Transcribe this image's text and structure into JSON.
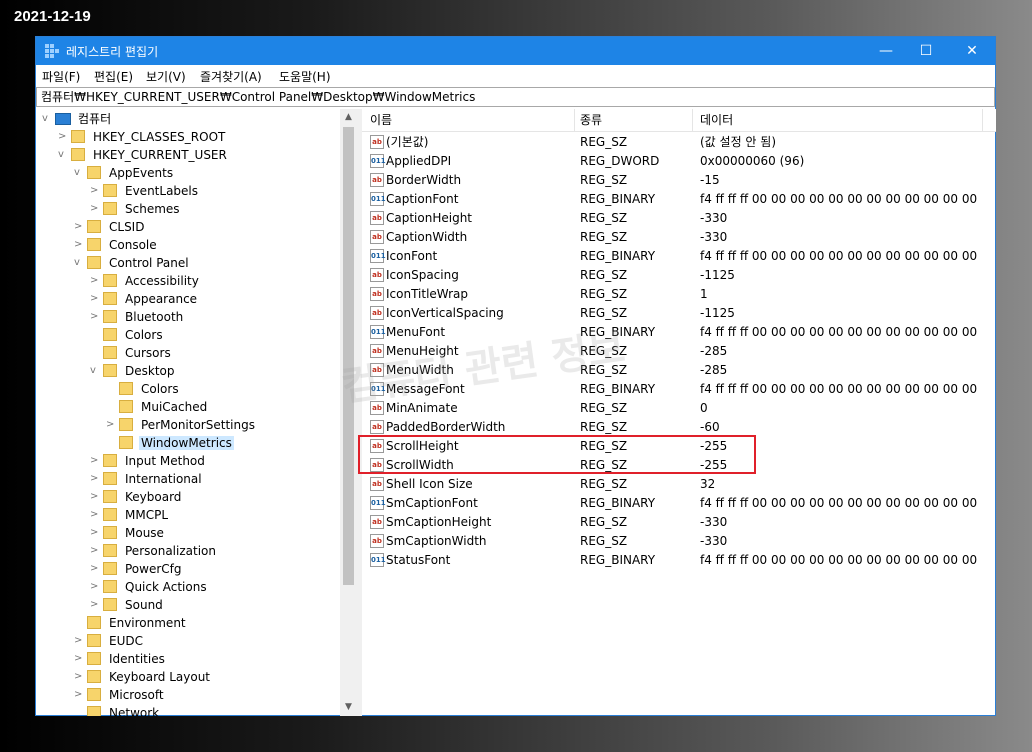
{
  "date_label": "2021-12-19",
  "window": {
    "title": "레지스트리 편집기",
    "minimize_glyph": "—",
    "maximize_glyph": "☐",
    "close_glyph": "✕",
    "title_icon": "registry-editor-icon"
  },
  "menubar": [
    "파일(F)",
    "편집(E)",
    "보기(V)",
    "즐겨찾기(A)",
    "도움말(H)"
  ],
  "address": "컴퓨터₩HKEY_CURRENT_USER₩Control Panel₩Desktop₩WindowMetrics",
  "tree": {
    "root": "컴퓨터",
    "nodes": [
      {
        "label": "HKEY_CLASSES_ROOT",
        "level": 1,
        "expander": ">"
      },
      {
        "label": "HKEY_CURRENT_USER",
        "level": 1,
        "expander": "v"
      },
      {
        "label": "AppEvents",
        "level": 2,
        "expander": "v"
      },
      {
        "label": "EventLabels",
        "level": 3,
        "expander": ">"
      },
      {
        "label": "Schemes",
        "level": 3,
        "expander": ">"
      },
      {
        "label": "CLSID",
        "level": 2,
        "expander": ">"
      },
      {
        "label": "Console",
        "level": 2,
        "expander": ">"
      },
      {
        "label": "Control Panel",
        "level": 2,
        "expander": "v"
      },
      {
        "label": "Accessibility",
        "level": 3,
        "expander": ">"
      },
      {
        "label": "Appearance",
        "level": 3,
        "expander": ">"
      },
      {
        "label": "Bluetooth",
        "level": 3,
        "expander": ">"
      },
      {
        "label": "Colors",
        "level": 3,
        "expander": ""
      },
      {
        "label": "Cursors",
        "level": 3,
        "expander": ""
      },
      {
        "label": "Desktop",
        "level": 3,
        "expander": "v"
      },
      {
        "label": "Colors",
        "level": 4,
        "expander": ""
      },
      {
        "label": "MuiCached",
        "level": 4,
        "expander": ""
      },
      {
        "label": "PerMonitorSettings",
        "level": 4,
        "expander": ">"
      },
      {
        "label": "WindowMetrics",
        "level": 4,
        "expander": "",
        "selected": true
      },
      {
        "label": "Input Method",
        "level": 3,
        "expander": ">"
      },
      {
        "label": "International",
        "level": 3,
        "expander": ">"
      },
      {
        "label": "Keyboard",
        "level": 3,
        "expander": ">"
      },
      {
        "label": "MMCPL",
        "level": 3,
        "expander": ">"
      },
      {
        "label": "Mouse",
        "level": 3,
        "expander": ">"
      },
      {
        "label": "Personalization",
        "level": 3,
        "expander": ">"
      },
      {
        "label": "PowerCfg",
        "level": 3,
        "expander": ">"
      },
      {
        "label": "Quick Actions",
        "level": 3,
        "expander": ">"
      },
      {
        "label": "Sound",
        "level": 3,
        "expander": ">"
      },
      {
        "label": "Environment",
        "level": 2,
        "expander": ""
      },
      {
        "label": "EUDC",
        "level": 2,
        "expander": ">"
      },
      {
        "label": "Identities",
        "level": 2,
        "expander": ">"
      },
      {
        "label": "Keyboard Layout",
        "level": 2,
        "expander": ">"
      },
      {
        "label": "Microsoft",
        "level": 2,
        "expander": ">"
      },
      {
        "label": "Network",
        "level": 2,
        "expander": ""
      }
    ]
  },
  "list": {
    "headers": [
      "이름",
      "종류",
      "데이터"
    ],
    "rows": [
      {
        "name": "(기본값)",
        "type": "REG_SZ",
        "data": "(값 설정 안 됨)",
        "icon": "ab"
      },
      {
        "name": "AppliedDPI",
        "type": "REG_DWORD",
        "data": "0x00000060 (96)",
        "icon": "bin"
      },
      {
        "name": "BorderWidth",
        "type": "REG_SZ",
        "data": "-15",
        "icon": "ab"
      },
      {
        "name": "CaptionFont",
        "type": "REG_BINARY",
        "data": "f4 ff ff ff 00 00 00 00 00 00 00 00 00 00 00 00 ...",
        "icon": "bin"
      },
      {
        "name": "CaptionHeight",
        "type": "REG_SZ",
        "data": "-330",
        "icon": "ab"
      },
      {
        "name": "CaptionWidth",
        "type": "REG_SZ",
        "data": "-330",
        "icon": "ab"
      },
      {
        "name": "IconFont",
        "type": "REG_BINARY",
        "data": "f4 ff ff ff 00 00 00 00 00 00 00 00 00 00 00 00 ...",
        "icon": "bin"
      },
      {
        "name": "IconSpacing",
        "type": "REG_SZ",
        "data": "-1125",
        "icon": "ab"
      },
      {
        "name": "IconTitleWrap",
        "type": "REG_SZ",
        "data": "1",
        "icon": "ab"
      },
      {
        "name": "IconVerticalSpacing",
        "type": "REG_SZ",
        "data": "-1125",
        "icon": "ab"
      },
      {
        "name": "MenuFont",
        "type": "REG_BINARY",
        "data": "f4 ff ff ff 00 00 00 00 00 00 00 00 00 00 00 00 ...",
        "icon": "bin"
      },
      {
        "name": "MenuHeight",
        "type": "REG_SZ",
        "data": "-285",
        "icon": "ab"
      },
      {
        "name": "MenuWidth",
        "type": "REG_SZ",
        "data": "-285",
        "icon": "ab"
      },
      {
        "name": "MessageFont",
        "type": "REG_BINARY",
        "data": "f4 ff ff ff 00 00 00 00 00 00 00 00 00 00 00 00 ...",
        "icon": "bin"
      },
      {
        "name": "MinAnimate",
        "type": "REG_SZ",
        "data": "0",
        "icon": "ab"
      },
      {
        "name": "PaddedBorderWidth",
        "type": "REG_SZ",
        "data": "-60",
        "icon": "ab"
      },
      {
        "name": "ScrollHeight",
        "type": "REG_SZ",
        "data": "-255",
        "icon": "ab"
      },
      {
        "name": "ScrollWidth",
        "type": "REG_SZ",
        "data": "-255",
        "icon": "ab"
      },
      {
        "name": "Shell Icon Size",
        "type": "REG_SZ",
        "data": "32",
        "icon": "ab"
      },
      {
        "name": "SmCaptionFont",
        "type": "REG_BINARY",
        "data": "f4 ff ff ff 00 00 00 00 00 00 00 00 00 00 00 00 ...",
        "icon": "bin"
      },
      {
        "name": "SmCaptionHeight",
        "type": "REG_SZ",
        "data": "-330",
        "icon": "ab"
      },
      {
        "name": "SmCaptionWidth",
        "type": "REG_SZ",
        "data": "-330",
        "icon": "ab"
      },
      {
        "name": "StatusFont",
        "type": "REG_BINARY",
        "data": "f4 ff ff ff 00 00 00 00 00 00 00 00 00 00 00 00 ...",
        "icon": "bin"
      }
    ]
  },
  "watermark": "컴퓨터 관련 정보",
  "colors": {
    "titlebar": "#1e84e6",
    "highlight": "#e0202a",
    "selection": "#cde8ff"
  }
}
